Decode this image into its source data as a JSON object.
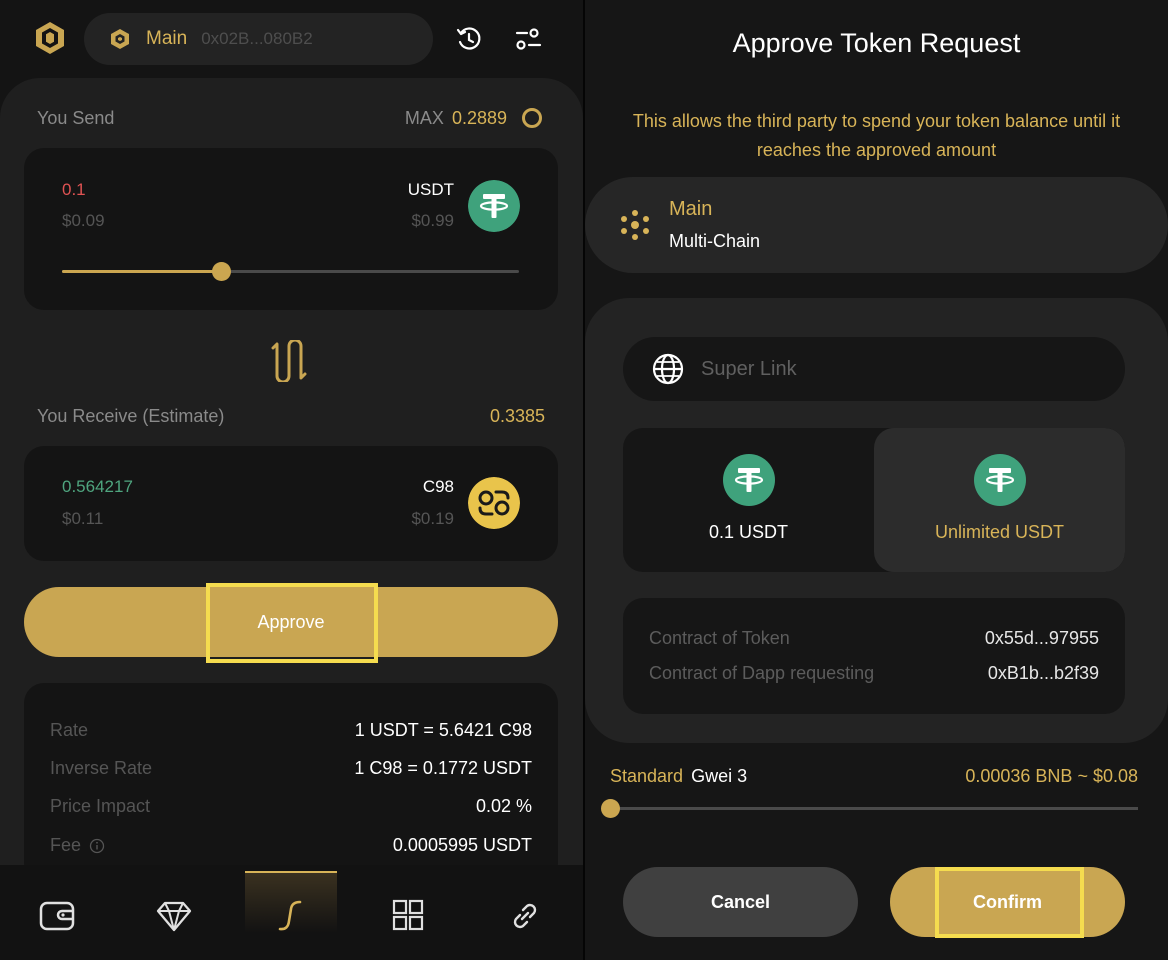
{
  "colors": {
    "accent": "#c9a652",
    "gold_text": "#d8b458",
    "highlight": "#f5dc4f",
    "usdt_green": "#3fa27c",
    "c98_yellow": "#e9c44b"
  },
  "left": {
    "header": {
      "wallet_name": "Main",
      "wallet_address": "0x02B...080B2",
      "icons": [
        "coin98-logo-icon",
        "wallet-icon",
        "history-icon",
        "settings-sliders-icon"
      ]
    },
    "send": {
      "label": "You Send",
      "max_label": "MAX",
      "max_value": "0.2889",
      "amount": "0.1",
      "amount_usd": "$0.09",
      "token": "USDT",
      "token_price": "$0.99",
      "slider_fraction": 0.35
    },
    "swap_icon": "swap-arrows-icon",
    "receive": {
      "label": "You Receive (Estimate)",
      "balance": "0.3385",
      "amount": "0.564217",
      "amount_usd": "$0.11",
      "token": "C98",
      "token_price": "$0.19"
    },
    "approve_label": "Approve",
    "details": [
      {
        "label": "Rate",
        "value": "1 USDT = 5.6421 C98"
      },
      {
        "label": "Inverse Rate",
        "value": "1 C98 = 0.1772 USDT"
      },
      {
        "label": "Price Impact",
        "value": "0.02 %"
      },
      {
        "label": "Fee",
        "value": "0.0005995 USDT"
      }
    ],
    "nav": [
      "wallet-icon",
      "diamond-icon",
      "swap-icon",
      "apps-grid-icon",
      "link-icon"
    ],
    "nav_active": "swap-icon"
  },
  "right": {
    "title": "Approve Token Request",
    "subtitle": "This allows the third party to spend your token balance until it reaches the approved amount",
    "account": {
      "name": "Main",
      "chain": "Multi-Chain"
    },
    "dapp_name": "Super Link",
    "options": [
      {
        "label": "0.1 USDT",
        "selected": false
      },
      {
        "label": "Unlimited USDT",
        "selected": true
      }
    ],
    "contracts": [
      {
        "label": "Contract of Token",
        "value": "0x55d...97955"
      },
      {
        "label": "Contract of Dapp requesting",
        "value": "0xB1b...b2f39"
      }
    ],
    "gas": {
      "speed": "Standard",
      "gwei_label": "Gwei 3",
      "fee": "0.00036 BNB ~ $0.08",
      "slider_fraction": 0
    },
    "cancel_label": "Cancel",
    "confirm_label": "Confirm"
  }
}
